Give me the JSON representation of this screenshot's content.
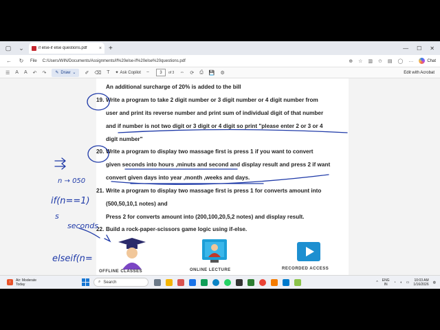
{
  "browser": {
    "tab_title": "if else-if else questions.pdf",
    "tab_close": "×",
    "new_tab": "+",
    "win_min": "—",
    "win_max": "☐",
    "win_close": "✕",
    "addr_label": "File",
    "url": "C:/Users/WIN/Documents/Assignments/if%20else-if%20else%20questions.pdf",
    "chat_label": "Chat"
  },
  "pdf_toolbar": {
    "draw_label": "Draw",
    "copilot_label": "Ask Copilot",
    "page_current": "3",
    "page_total_text": "of 3",
    "acrobat_label": "Edit with Acrobat"
  },
  "document": {
    "lines": [
      "An additional surcharge of 20% is added to the bill",
      "Write a program to take 2 digit number  or 3 digit number or 4 digit number from",
      "user and print its reverse number and print sum of individual digit of that number",
      "and if number is not two digit or 3 digit or 4 digit so print \"please enter 2 or 3 or 4",
      "digit number\"",
      "Write a program to display two massage first is press  1 if you want to convert",
      "given seconds into hours ,minuts and second and display result and press 2 if want",
      "convert given days into year ,month ,weeks and days.",
      "Write a program to display  two massage first is press 1 for converts amount into",
      "(500,50,10,1 notes) and",
      "Press 2 for converts amount into (200,100,20,5,2 notes) and display result.",
      "Build a rock-paper-scissors game logic using if-else."
    ],
    "numbers": [
      "19.",
      "20.",
      "21.",
      "22."
    ],
    "footer_labels": [
      "OFFLINE CLASSES",
      "ONLINE LECTURE",
      "RECORDED ACCESS"
    ]
  },
  "handwriting": {
    "text1": "n → 050",
    "text2": "if(n==1)",
    "text3": "seconds",
    "text4": "elseif(n=",
    "text5": "s"
  },
  "taskbar": {
    "weather_title": "Air: Moderate",
    "weather_sub": "Today",
    "search_placeholder": "Search",
    "lang_top": "ENG",
    "lang_bottom": "IN",
    "time": "10:03 AM",
    "date": "1/16/2026"
  },
  "colors": {
    "ink": "#1f3aa8",
    "pdf_red": "#c4262e",
    "accent": "#1877d4"
  }
}
